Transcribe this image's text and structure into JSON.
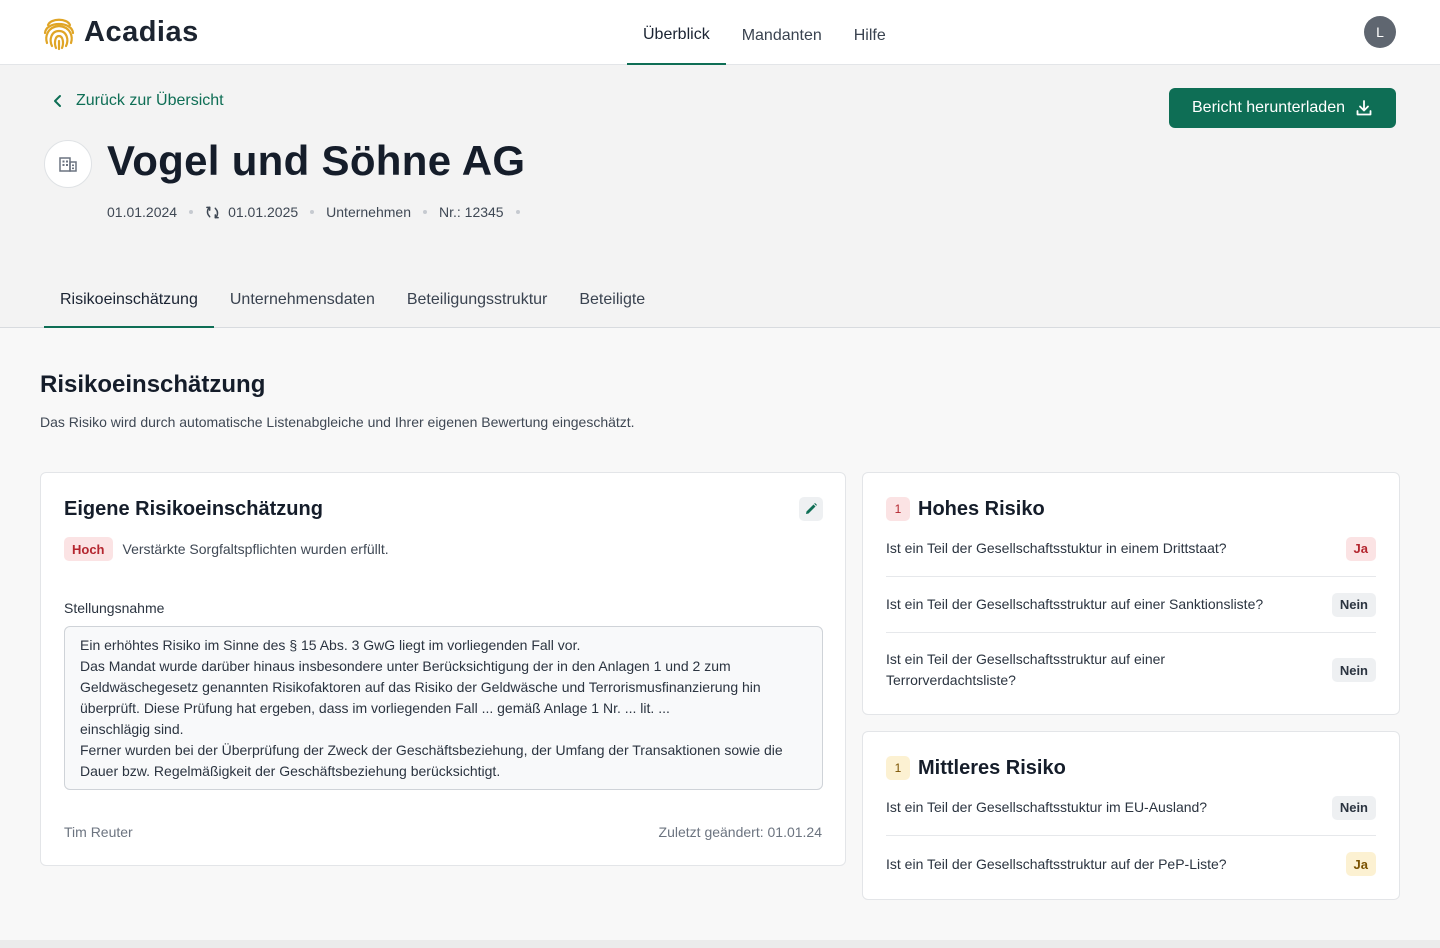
{
  "app": {
    "brand": "Acadias",
    "user_initial": "L"
  },
  "nav": {
    "items": [
      {
        "label": "Überblick",
        "active": true
      },
      {
        "label": "Mandanten",
        "active": false
      },
      {
        "label": "Hilfe",
        "active": false
      }
    ]
  },
  "header": {
    "back_label": "Zurück zur Übersicht",
    "download_label": "Bericht herunterladen",
    "company_name": "Vogel und Söhne AG",
    "meta": {
      "start_date": "01.01.2024",
      "renew_date": "01.01.2025",
      "type": "Unternehmen",
      "number": "Nr.: 12345"
    },
    "tabs": [
      {
        "label": "Risikoeinschätzung",
        "active": true
      },
      {
        "label": "Unternehmensdaten",
        "active": false
      },
      {
        "label": "Beteiligungsstruktur",
        "active": false
      },
      {
        "label": "Beteiligte",
        "active": false
      }
    ]
  },
  "section": {
    "title": "Risikoeinschätzung",
    "description": "Das Risiko wird durch automatische Listenabgleiche und Ihrer eigenen Bewertung eingeschätzt."
  },
  "own_assessment": {
    "title": "Eigene Risikoeinschätzung",
    "level_badge": "Hoch",
    "level_text": "Verstärkte Sorgfaltspflichten wurden erfüllt.",
    "statement_label": "Stellungsnahme",
    "statement_lines": [
      "Ein erhöhtes Risiko im Sinne des § 15 Abs. 3 GwG liegt im vorliegenden Fall vor.",
      "Das Mandat wurde darüber hinaus insbesondere unter Berücksichtigung der in den Anlagen 1 und 2 zum Geldwäschegesetz genannten Risikofaktoren auf das Risiko der Geldwäsche und Terrorismusfinanzierung hin überprüft. Diese Prüfung hat ergeben, dass im vorliegenden Fall ... gemäß Anlage 1 Nr. ... lit. ...",
      "einschlägig sind.",
      "Ferner wurden bei der Überprüfung der Zweck der Geschäftsbeziehung, der Umfang der Transaktionen sowie die Dauer bzw. Regelmäßigkeit der Geschäftsbeziehung berücksichtigt."
    ],
    "author": "Tim Reuter",
    "last_changed": "Zuletzt geändert: 01.01.24"
  },
  "high_risk": {
    "count": "1",
    "title": "Hohes Risiko",
    "questions": [
      {
        "text": "Ist ein Teil der Gesellschaftsstuktur in einem Drittstaat?",
        "answer": "Ja",
        "tone": "red"
      },
      {
        "text": "Ist ein Teil der Gesellschaftsstruktur auf einer Sanktionsliste?",
        "answer": "Nein",
        "tone": "gray"
      },
      {
        "text": "Ist ein Teil der Gesellschaftsstruktur auf einer Terrorverdachtsliste?",
        "answer": "Nein",
        "tone": "gray"
      }
    ]
  },
  "mid_risk": {
    "count": "1",
    "title": "Mittleres Risiko",
    "questions": [
      {
        "text": "Ist ein Teil der Gesellschaftsstuktur im EU-Ausland?",
        "answer": "Nein",
        "tone": "gray"
      },
      {
        "text": "Ist ein Teil der Gesellschaftsstruktur auf der PeP-Liste?",
        "answer": "Ja",
        "tone": "yellow"
      }
    ]
  },
  "colors": {
    "brand_green": "#0e6e55",
    "logo_gold": "#e0a526",
    "high_badge_bg": "#fbe3e4",
    "mid_badge_bg": "#fcf1d2"
  }
}
